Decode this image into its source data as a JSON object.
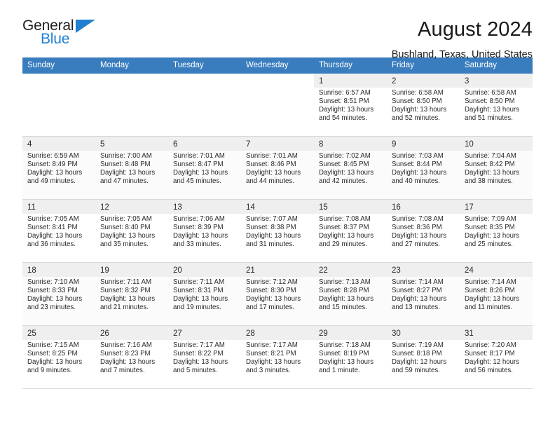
{
  "logo": {
    "word_one": "General",
    "word_two": "Blue",
    "triangle_icon": "triangle-icon",
    "accent_color": "#1f7fd0"
  },
  "header": {
    "title": "August 2024",
    "subtitle": "Bushland, Texas, United States"
  },
  "calendar": {
    "header_color": "#3a7dbe",
    "weekday_headers": [
      "Sunday",
      "Monday",
      "Tuesday",
      "Wednesday",
      "Thursday",
      "Friday",
      "Saturday"
    ],
    "labels": {
      "sunrise": "Sunrise:",
      "sunset": "Sunset:",
      "daylight": "Daylight:"
    },
    "weeks": [
      [
        {
          "day": "",
          "sunrise": "",
          "sunset": "",
          "daylight_line1": "",
          "daylight_line2": ""
        },
        {
          "day": "",
          "sunrise": "",
          "sunset": "",
          "daylight_line1": "",
          "daylight_line2": ""
        },
        {
          "day": "",
          "sunrise": "",
          "sunset": "",
          "daylight_line1": "",
          "daylight_line2": ""
        },
        {
          "day": "",
          "sunrise": "",
          "sunset": "",
          "daylight_line1": "",
          "daylight_line2": ""
        },
        {
          "day": "1",
          "sunrise": "Sunrise: 6:57 AM",
          "sunset": "Sunset: 8:51 PM",
          "daylight_line1": "Daylight: 13 hours",
          "daylight_line2": "and 54 minutes."
        },
        {
          "day": "2",
          "sunrise": "Sunrise: 6:58 AM",
          "sunset": "Sunset: 8:50 PM",
          "daylight_line1": "Daylight: 13 hours",
          "daylight_line2": "and 52 minutes."
        },
        {
          "day": "3",
          "sunrise": "Sunrise: 6:58 AM",
          "sunset": "Sunset: 8:50 PM",
          "daylight_line1": "Daylight: 13 hours",
          "daylight_line2": "and 51 minutes."
        }
      ],
      [
        {
          "day": "4",
          "sunrise": "Sunrise: 6:59 AM",
          "sunset": "Sunset: 8:49 PM",
          "daylight_line1": "Daylight: 13 hours",
          "daylight_line2": "and 49 minutes."
        },
        {
          "day": "5",
          "sunrise": "Sunrise: 7:00 AM",
          "sunset": "Sunset: 8:48 PM",
          "daylight_line1": "Daylight: 13 hours",
          "daylight_line2": "and 47 minutes."
        },
        {
          "day": "6",
          "sunrise": "Sunrise: 7:01 AM",
          "sunset": "Sunset: 8:47 PM",
          "daylight_line1": "Daylight: 13 hours",
          "daylight_line2": "and 45 minutes."
        },
        {
          "day": "7",
          "sunrise": "Sunrise: 7:01 AM",
          "sunset": "Sunset: 8:46 PM",
          "daylight_line1": "Daylight: 13 hours",
          "daylight_line2": "and 44 minutes."
        },
        {
          "day": "8",
          "sunrise": "Sunrise: 7:02 AM",
          "sunset": "Sunset: 8:45 PM",
          "daylight_line1": "Daylight: 13 hours",
          "daylight_line2": "and 42 minutes."
        },
        {
          "day": "9",
          "sunrise": "Sunrise: 7:03 AM",
          "sunset": "Sunset: 8:44 PM",
          "daylight_line1": "Daylight: 13 hours",
          "daylight_line2": "and 40 minutes."
        },
        {
          "day": "10",
          "sunrise": "Sunrise: 7:04 AM",
          "sunset": "Sunset: 8:42 PM",
          "daylight_line1": "Daylight: 13 hours",
          "daylight_line2": "and 38 minutes."
        }
      ],
      [
        {
          "day": "11",
          "sunrise": "Sunrise: 7:05 AM",
          "sunset": "Sunset: 8:41 PM",
          "daylight_line1": "Daylight: 13 hours",
          "daylight_line2": "and 36 minutes."
        },
        {
          "day": "12",
          "sunrise": "Sunrise: 7:05 AM",
          "sunset": "Sunset: 8:40 PM",
          "daylight_line1": "Daylight: 13 hours",
          "daylight_line2": "and 35 minutes."
        },
        {
          "day": "13",
          "sunrise": "Sunrise: 7:06 AM",
          "sunset": "Sunset: 8:39 PM",
          "daylight_line1": "Daylight: 13 hours",
          "daylight_line2": "and 33 minutes."
        },
        {
          "day": "14",
          "sunrise": "Sunrise: 7:07 AM",
          "sunset": "Sunset: 8:38 PM",
          "daylight_line1": "Daylight: 13 hours",
          "daylight_line2": "and 31 minutes."
        },
        {
          "day": "15",
          "sunrise": "Sunrise: 7:08 AM",
          "sunset": "Sunset: 8:37 PM",
          "daylight_line1": "Daylight: 13 hours",
          "daylight_line2": "and 29 minutes."
        },
        {
          "day": "16",
          "sunrise": "Sunrise: 7:08 AM",
          "sunset": "Sunset: 8:36 PM",
          "daylight_line1": "Daylight: 13 hours",
          "daylight_line2": "and 27 minutes."
        },
        {
          "day": "17",
          "sunrise": "Sunrise: 7:09 AM",
          "sunset": "Sunset: 8:35 PM",
          "daylight_line1": "Daylight: 13 hours",
          "daylight_line2": "and 25 minutes."
        }
      ],
      [
        {
          "day": "18",
          "sunrise": "Sunrise: 7:10 AM",
          "sunset": "Sunset: 8:33 PM",
          "daylight_line1": "Daylight: 13 hours",
          "daylight_line2": "and 23 minutes."
        },
        {
          "day": "19",
          "sunrise": "Sunrise: 7:11 AM",
          "sunset": "Sunset: 8:32 PM",
          "daylight_line1": "Daylight: 13 hours",
          "daylight_line2": "and 21 minutes."
        },
        {
          "day": "20",
          "sunrise": "Sunrise: 7:11 AM",
          "sunset": "Sunset: 8:31 PM",
          "daylight_line1": "Daylight: 13 hours",
          "daylight_line2": "and 19 minutes."
        },
        {
          "day": "21",
          "sunrise": "Sunrise: 7:12 AM",
          "sunset": "Sunset: 8:30 PM",
          "daylight_line1": "Daylight: 13 hours",
          "daylight_line2": "and 17 minutes."
        },
        {
          "day": "22",
          "sunrise": "Sunrise: 7:13 AM",
          "sunset": "Sunset: 8:28 PM",
          "daylight_line1": "Daylight: 13 hours",
          "daylight_line2": "and 15 minutes."
        },
        {
          "day": "23",
          "sunrise": "Sunrise: 7:14 AM",
          "sunset": "Sunset: 8:27 PM",
          "daylight_line1": "Daylight: 13 hours",
          "daylight_line2": "and 13 minutes."
        },
        {
          "day": "24",
          "sunrise": "Sunrise: 7:14 AM",
          "sunset": "Sunset: 8:26 PM",
          "daylight_line1": "Daylight: 13 hours",
          "daylight_line2": "and 11 minutes."
        }
      ],
      [
        {
          "day": "25",
          "sunrise": "Sunrise: 7:15 AM",
          "sunset": "Sunset: 8:25 PM",
          "daylight_line1": "Daylight: 13 hours",
          "daylight_line2": "and 9 minutes."
        },
        {
          "day": "26",
          "sunrise": "Sunrise: 7:16 AM",
          "sunset": "Sunset: 8:23 PM",
          "daylight_line1": "Daylight: 13 hours",
          "daylight_line2": "and 7 minutes."
        },
        {
          "day": "27",
          "sunrise": "Sunrise: 7:17 AM",
          "sunset": "Sunset: 8:22 PM",
          "daylight_line1": "Daylight: 13 hours",
          "daylight_line2": "and 5 minutes."
        },
        {
          "day": "28",
          "sunrise": "Sunrise: 7:17 AM",
          "sunset": "Sunset: 8:21 PM",
          "daylight_line1": "Daylight: 13 hours",
          "daylight_line2": "and 3 minutes."
        },
        {
          "day": "29",
          "sunrise": "Sunrise: 7:18 AM",
          "sunset": "Sunset: 8:19 PM",
          "daylight_line1": "Daylight: 13 hours",
          "daylight_line2": "and 1 minute."
        },
        {
          "day": "30",
          "sunrise": "Sunrise: 7:19 AM",
          "sunset": "Sunset: 8:18 PM",
          "daylight_line1": "Daylight: 12 hours",
          "daylight_line2": "and 59 minutes."
        },
        {
          "day": "31",
          "sunrise": "Sunrise: 7:20 AM",
          "sunset": "Sunset: 8:17 PM",
          "daylight_line1": "Daylight: 12 hours",
          "daylight_line2": "and 56 minutes."
        }
      ]
    ]
  }
}
